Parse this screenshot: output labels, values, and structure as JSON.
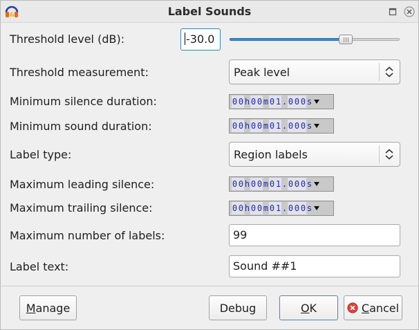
{
  "window": {
    "title": "Label Sounds",
    "app_icon": "audacity-headphones-icon"
  },
  "fields": {
    "threshold_level": {
      "label": "Threshold level (dB):",
      "value": "-30.0",
      "slider_fraction": 0.7
    },
    "threshold_measurement": {
      "label": "Threshold measurement:",
      "selected": "Peak level"
    },
    "min_silence": {
      "label": "Minimum silence duration:",
      "value": "00h00m01.000s"
    },
    "min_sound": {
      "label": "Minimum sound duration:",
      "value": "00h00m01.000s"
    },
    "label_type": {
      "label": "Label type:",
      "selected": "Region labels"
    },
    "max_leading": {
      "label": "Maximum leading silence:",
      "value": "00h00m01.000s"
    },
    "max_trailing": {
      "label": "Maximum trailing silence:",
      "value": "00h00m01.000s"
    },
    "max_labels": {
      "label": "Maximum number of labels:",
      "value": "99"
    },
    "label_text": {
      "label": "Label text:",
      "value": "Sound ##1"
    }
  },
  "buttons": {
    "manage": {
      "mnemonic": "M",
      "rest": "anage"
    },
    "debug": {
      "pre": "Debu",
      "mnemonic": "g"
    },
    "ok": {
      "mnemonic": "O",
      "rest": "K"
    },
    "cancel": {
      "mnemonic": "C",
      "rest": "ancel"
    }
  },
  "colors": {
    "accent": "#3d8bd0",
    "time_digits": "#1f28a8",
    "cancel_icon": "#d9443a"
  }
}
